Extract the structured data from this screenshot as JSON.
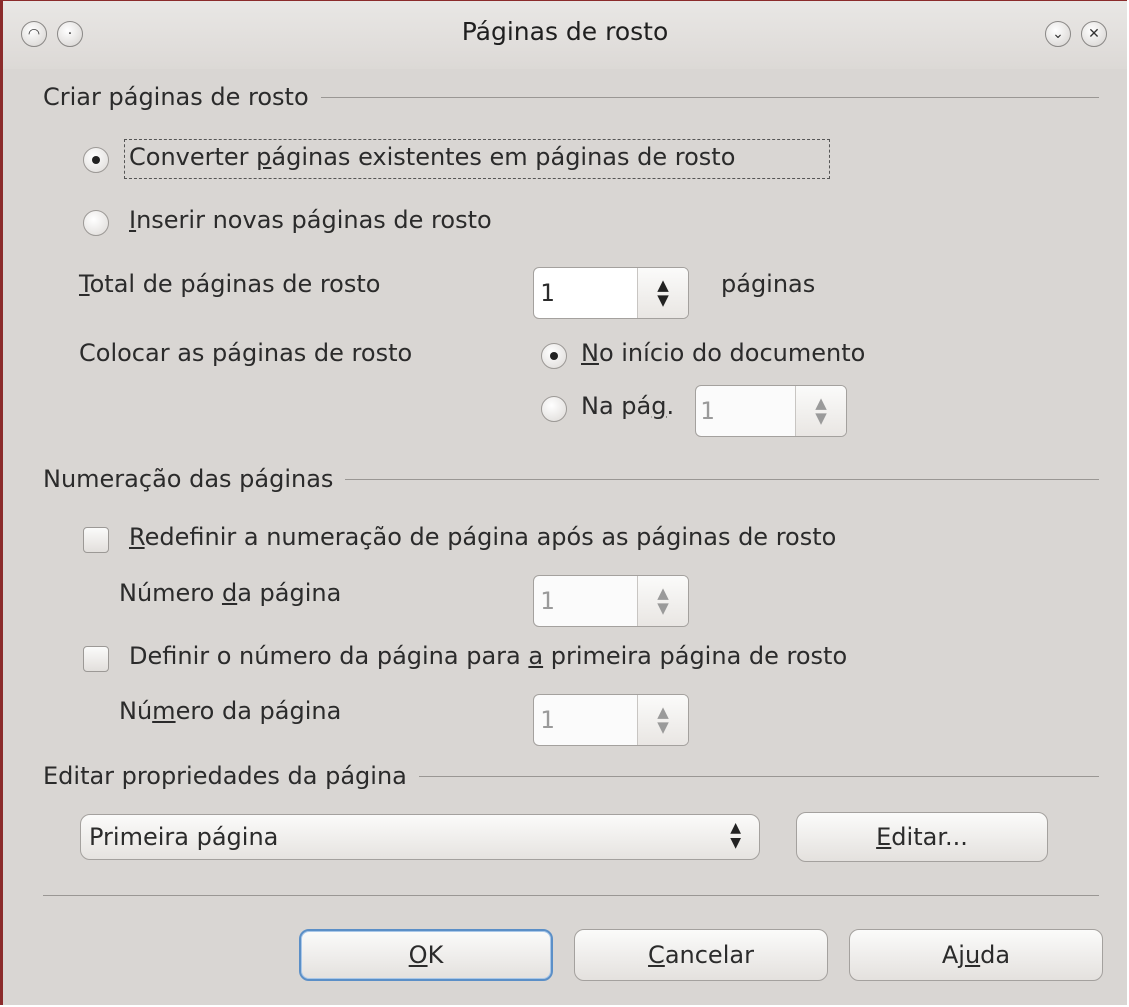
{
  "window": {
    "title": "Páginas de rosto",
    "icons": [
      "menu-icon",
      "shade-icon",
      "minimize-icon",
      "close-icon"
    ]
  },
  "create": {
    "section_label": "Criar páginas de rosto",
    "convert_existing": {
      "pre": "Converter ",
      "u": "p",
      "post": "áginas existentes em páginas de rosto",
      "checked": true
    },
    "insert_new": {
      "pre": "",
      "u": "I",
      "post": "nserir novas páginas de rosto",
      "checked": false
    },
    "total_label": {
      "pre": "",
      "u": "T",
      "post": "otal de páginas de rosto"
    },
    "total_value": "1",
    "total_unit": "páginas",
    "place_label": "Colocar as páginas de rosto",
    "at_start": {
      "pre": "",
      "u": "N",
      "post": "o início do documento",
      "checked": true
    },
    "on_page": {
      "pre": "Na pá",
      "u": "g",
      "post": ".",
      "checked": false
    },
    "on_page_value": "1"
  },
  "numbering": {
    "section_label": "Numeração das páginas",
    "reset": {
      "pre": "",
      "u": "R",
      "post": "edefinir a numeração de página após as páginas de rosto",
      "checked": false
    },
    "reset_page_label": {
      "pre": "Número ",
      "u": "d",
      "post": "a página"
    },
    "reset_page_value": "1",
    "set_first": {
      "pre": "Definir o número da página para ",
      "u": "a",
      "post": " primeira página de rosto",
      "checked": false
    },
    "set_first_label": {
      "pre": "Nú",
      "u": "m",
      "post": "ero da página"
    },
    "set_first_value": "1"
  },
  "edit": {
    "section_label": "Editar propriedades da página",
    "selected": "Primeira página",
    "edit_button": {
      "pre": "",
      "u": "E",
      "post": "ditar..."
    }
  },
  "buttons": {
    "ok": {
      "pre": "",
      "u": "O",
      "post": "K"
    },
    "cancel": {
      "pre": "",
      "u": "C",
      "post": "ancelar"
    },
    "help": {
      "pre": "Aj",
      "u": "u",
      "post": "da"
    }
  }
}
